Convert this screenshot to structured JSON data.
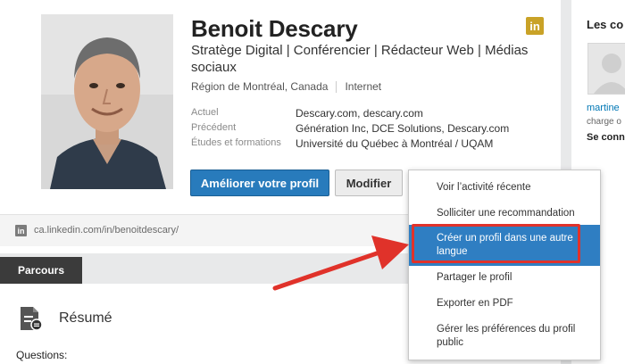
{
  "profile": {
    "name": "Benoit Descary",
    "headline": "Stratège Digital | Conférencier | Rédacteur Web | Médias sociaux",
    "location": "Région de Montréal, Canada",
    "industry": "Internet",
    "badge_letters": "in",
    "info": [
      {
        "label": "Actuel",
        "value": "Descary.com, descary.com"
      },
      {
        "label": "Précédent",
        "value": "Génération Inc, DCE Solutions, Descary.com"
      },
      {
        "label": "Études et formations",
        "value": "Université du Québec à Montréal / UQAM"
      }
    ],
    "buttons": {
      "improve": "Améliorer votre profil",
      "edit": "Modifier"
    },
    "url": "ca.linkedin.com/in/benoitdescary/",
    "url_icon_letters": "in"
  },
  "section": {
    "tab": "Parcours",
    "title": "Résumé",
    "first_line": "Questions:"
  },
  "right_panel": {
    "title": "Les co",
    "person_name": "martine",
    "person_sub": "charge o",
    "link": "Se conn"
  },
  "dropdown": {
    "items": [
      "Voir l’activité récente",
      "Solliciter une recommandation",
      "Créer un profil dans une autre langue",
      "Partager le profil",
      "Exporter en PDF",
      "Gérer les préférences du profil public"
    ],
    "active_index": 2
  },
  "colors": {
    "primary": "#287bbc",
    "active_menu": "#2f7ec2",
    "annotation_red": "#e0322a",
    "badge_gold": "#c9a227",
    "tab_dark": "#3b3b3b"
  }
}
